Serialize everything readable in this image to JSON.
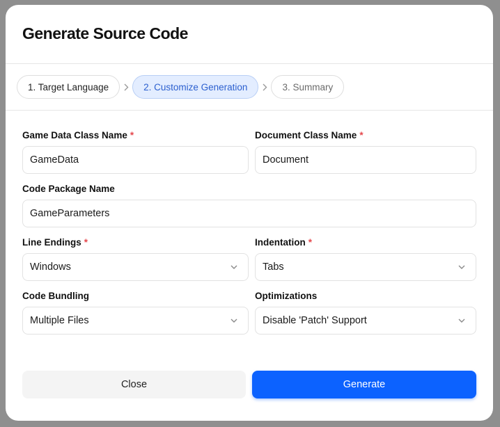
{
  "dialog": {
    "title": "Generate Source Code"
  },
  "steps": [
    {
      "label": "1. Target Language",
      "state": "done"
    },
    {
      "label": "2. Customize Generation",
      "state": "active"
    },
    {
      "label": "3. Summary",
      "state": "upcoming"
    }
  ],
  "form": {
    "game_data_class": {
      "label": "Game Data Class Name",
      "required": "*",
      "value": "GameData"
    },
    "document_class": {
      "label": "Document Class Name",
      "required": "*",
      "value": "Document"
    },
    "code_package": {
      "label": "Code Package Name",
      "value": "GameParameters"
    },
    "line_endings": {
      "label": "Line Endings",
      "required": "*",
      "value": "Windows"
    },
    "indentation": {
      "label": "Indentation",
      "required": "*",
      "value": "Tabs"
    },
    "code_bundling": {
      "label": "Code Bundling",
      "value": "Multiple Files"
    },
    "optimizations": {
      "label": "Optimizations",
      "value": "Disable 'Patch' Support"
    }
  },
  "footer": {
    "close_label": "Close",
    "generate_label": "Generate"
  },
  "colors": {
    "primary": "#0c62ff",
    "required": "#e5484d",
    "active_step_bg": "#e3edff",
    "active_step_text": "#2b5fcf"
  },
  "icons": {
    "step_separator": "chevron-right-icon",
    "select_arrow": "chevron-down-icon"
  }
}
